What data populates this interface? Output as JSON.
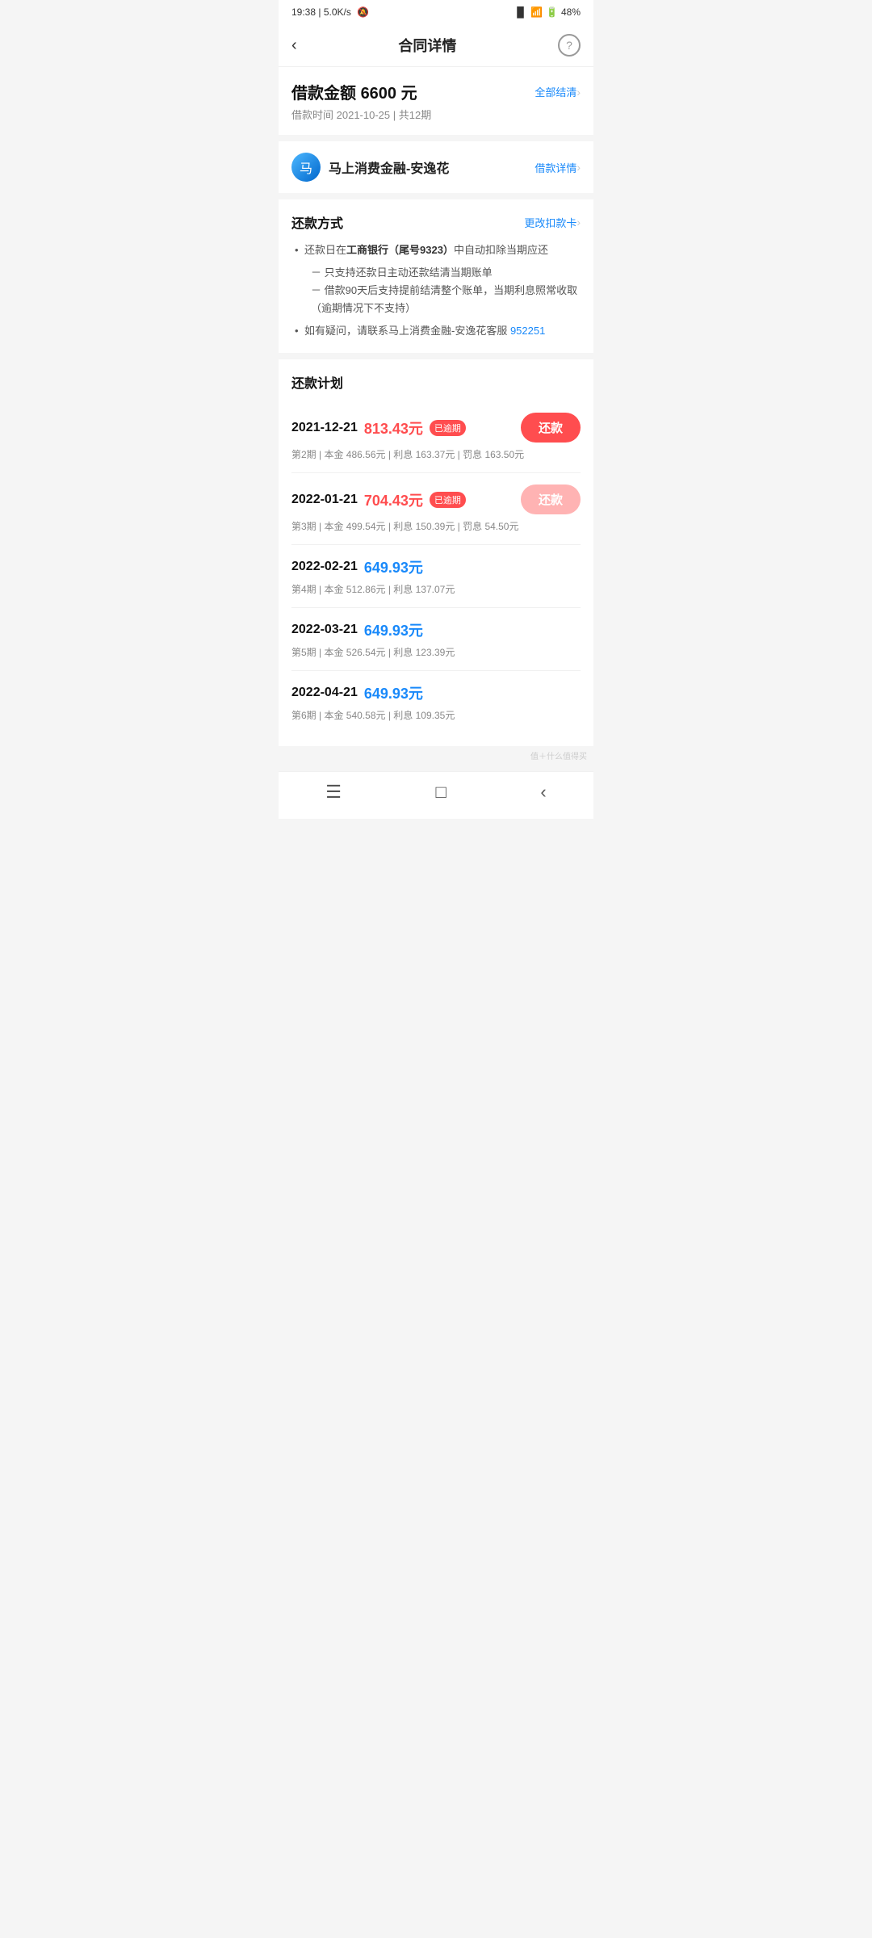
{
  "statusBar": {
    "time": "19:38",
    "network": "5.0K/s",
    "battery": "48%"
  },
  "header": {
    "title": "合同详情",
    "helpIcon": "?",
    "backIcon": "‹"
  },
  "loanInfo": {
    "label": "借款金额",
    "amount": "6600 元",
    "clearLink": "全部结清",
    "dateLabel": "借款时间",
    "date": "2021-10-25",
    "periodLabel": "共12期"
  },
  "company": {
    "name": "马上消费金融-安逸花",
    "detailLink": "借款详情",
    "iconText": "马"
  },
  "repayMethod": {
    "title": "还款方式",
    "changeLink": "更改扣款卡",
    "bullets": [
      {
        "type": "main",
        "text": "还款日在",
        "bank": "工商银行（尾号9323）",
        "textAfter": "中自动扣除当期应还"
      },
      {
        "type": "sub",
        "lines": [
          "－ 只支持还款日主动还款结清当期账单",
          "－ 借款90天后支持提前结清整个账单，当期利息照常收取（逾期情况下不支持）"
        ]
      },
      {
        "type": "main",
        "text": "如有疑问，请联系马上消费金融-安逸花客服",
        "phone": "952251"
      }
    ]
  },
  "repayPlan": {
    "title": "还款计划",
    "items": [
      {
        "date": "2021-12-21",
        "amount": "813.43元",
        "amountType": "overdue",
        "badge": "已逾期",
        "btnLabel": "还款",
        "btnType": "red",
        "detail": "第2期 | 本金 486.56元 | 利息 163.37元 | 罚息 163.50元"
      },
      {
        "date": "2022-01-21",
        "amount": "704.43元",
        "amountType": "overdue",
        "badge": "已逾期",
        "btnLabel": "还款",
        "btnType": "pink",
        "detail": "第3期 | 本金 499.54元 | 利息 150.39元 | 罚息 54.50元"
      },
      {
        "date": "2022-02-21",
        "amount": "649.93元",
        "amountType": "normal",
        "badge": "",
        "btnLabel": "",
        "btnType": "none",
        "detail": "第4期 | 本金 512.86元 | 利息 137.07元"
      },
      {
        "date": "2022-03-21",
        "amount": "649.93元",
        "amountType": "normal",
        "badge": "",
        "btnLabel": "",
        "btnType": "none",
        "detail": "第5期 | 本金 526.54元 | 利息 123.39元"
      },
      {
        "date": "2022-04-21",
        "amount": "649.93元",
        "amountType": "normal",
        "badge": "",
        "btnLabel": "",
        "btnType": "none",
        "detail": "第6期 | 本金 540.58元 | 利息 109.35元"
      }
    ]
  },
  "bottomNav": {
    "menu": "☰",
    "home": "□",
    "back": "‹"
  },
  "watermark": "值＋什么值得买"
}
